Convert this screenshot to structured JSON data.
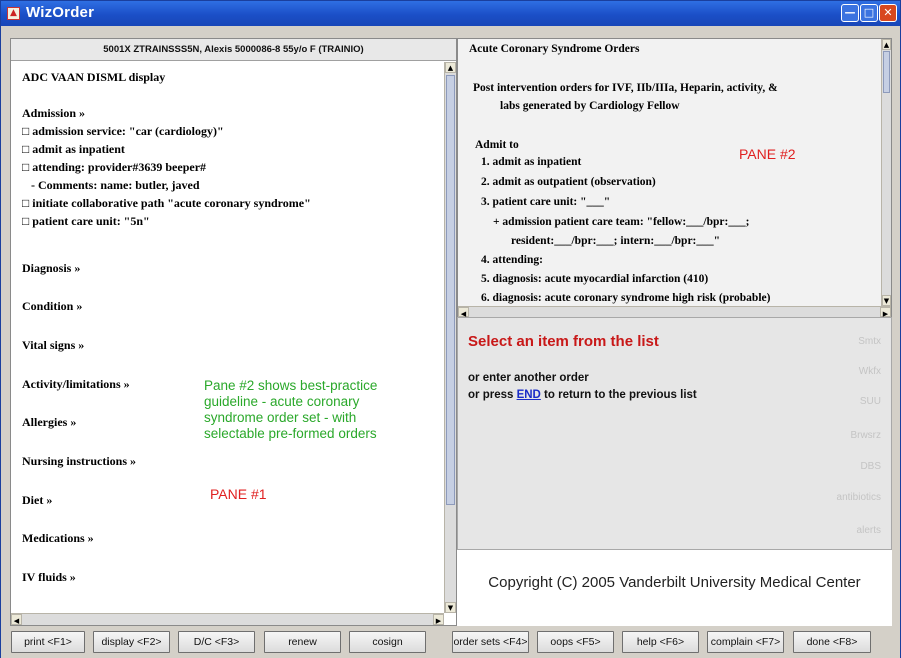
{
  "window": {
    "title": "WizOrder",
    "controls": [
      "minimize",
      "maximize",
      "close"
    ]
  },
  "patient_header": "5001X ZTRAINSSS5N, Alexis 5000086-8 55y/o F (TRAINIO)",
  "left_pane": {
    "title": "ADC VAAN DISML display",
    "lines": [
      {
        "text": "Admission »",
        "style": "section"
      },
      {
        "text": "□ admission service: \"car (cardiology)\"",
        "style": "item"
      },
      {
        "text": "□ admit as inpatient",
        "style": "item"
      },
      {
        "text": "□ attending: provider#3639  beeper#",
        "style": "item"
      },
      {
        "text": "   - Comments: name: butler, javed",
        "style": "item"
      },
      {
        "text": "□ initiate collaborative path \"acute coronary syndrome\"",
        "style": "item"
      },
      {
        "text": "□ patient care unit: \"5n\"",
        "style": "item"
      }
    ],
    "sections": [
      "Diagnosis »",
      "Condition »",
      "Vital signs »",
      "Activity/limitations »",
      "Allergies »",
      "Nursing instructions »",
      "Diet »",
      "Medications »",
      "IV fluids »"
    ]
  },
  "annotation_green": [
    "Pane #2 shows best-practice",
    "guideline - acute coronary",
    "syndrome order set - with",
    "selectable pre-formed orders"
  ],
  "annotation_pane1": "PANE #1",
  "annotation_pane2": "PANE #2",
  "right_pane": {
    "title": "Acute Coronary Syndrome Orders",
    "intro_line1": "Post intervention orders for IVF, IIb/IIIa, Heparin, activity, &",
    "intro_line2": "labs generated by Cardiology Fellow",
    "admit_heading": "Admit to",
    "orders": [
      "1. admit as inpatient",
      "2. admit as outpatient (observation)",
      "3. patient care unit: \"___\"",
      "+ admission patient care team: \"fellow:___/bpr:___;",
      "resident:___/bpr:___; intern:___/bpr:___\"",
      "4. attending:",
      "5. diagnosis:  acute myocardial infarction (410)",
      "6. diagnosis:  acute coronary syndrome high risk (probable)"
    ]
  },
  "select_panel": {
    "title": "Select an item from the list",
    "line1": "or enter another order",
    "line2_prefix": "or press ",
    "line2_link": "END",
    "line2_suffix": " to return to the previous list"
  },
  "ghost_labels": [
    "Smtx",
    "Wkfx",
    "SUU",
    "Brwsrz",
    "DBS",
    "antibiotics",
    "alerts"
  ],
  "copyright": "Copyright (C) 2005 Vanderbilt University Medical Center",
  "toolbar": {
    "buttons": [
      "print <F1>",
      "display <F2>",
      "D/C <F3>",
      "renew",
      "cosign",
      "order sets <F4>",
      "oops <F5>",
      "help <F6>",
      "complain <F7>",
      "done <F8>"
    ]
  }
}
